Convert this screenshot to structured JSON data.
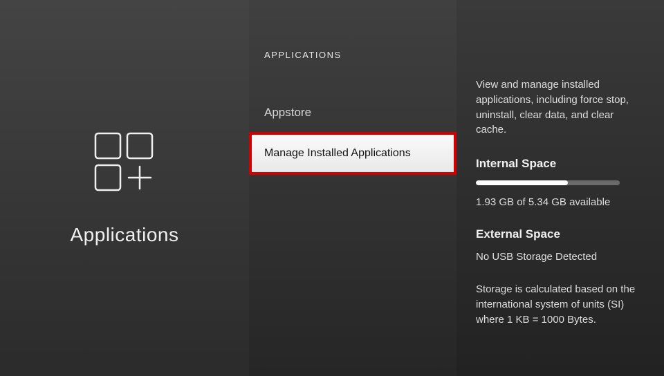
{
  "left": {
    "title": "Applications"
  },
  "middle": {
    "header": "APPLICATIONS",
    "items": [
      {
        "label": "Appstore"
      },
      {
        "label": "Manage Installed Applications"
      }
    ]
  },
  "right": {
    "description": "View and manage installed applications, including force stop, uninstall, clear data, and clear cache.",
    "internal_heading": "Internal Space",
    "storage_available": "1.93 GB of 5.34 GB available",
    "storage_fill_percent": 64,
    "external_heading": "External Space",
    "external_status": "No USB Storage Detected",
    "note": "Storage is calculated based on the international system of units (SI) where 1 KB = 1000 Bytes."
  }
}
